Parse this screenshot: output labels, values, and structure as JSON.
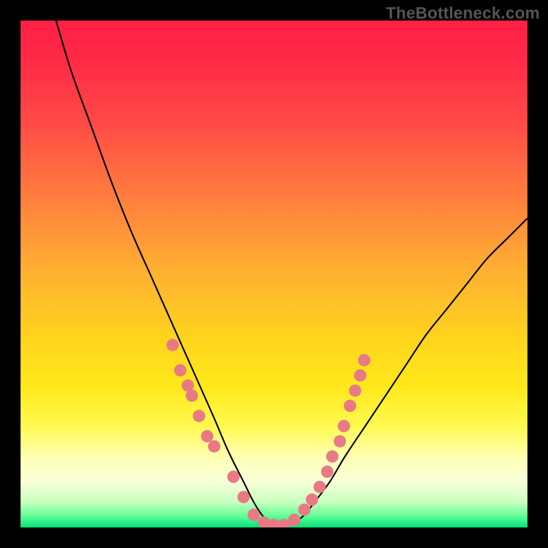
{
  "watermark": "TheBottleneck.com",
  "chart_data": {
    "type": "line",
    "title": "",
    "xlabel": "",
    "ylabel": "",
    "xlim": [
      0,
      100
    ],
    "ylim": [
      0,
      100
    ],
    "background_gradient": {
      "stops": [
        {
          "offset": 0.0,
          "color": "#ff1f44"
        },
        {
          "offset": 0.08,
          "color": "#ff2a47"
        },
        {
          "offset": 0.2,
          "color": "#ff4a46"
        },
        {
          "offset": 0.35,
          "color": "#ff7e3d"
        },
        {
          "offset": 0.5,
          "color": "#ffb230"
        },
        {
          "offset": 0.62,
          "color": "#ffd21e"
        },
        {
          "offset": 0.72,
          "color": "#ffe81a"
        },
        {
          "offset": 0.8,
          "color": "#fff94f"
        },
        {
          "offset": 0.86,
          "color": "#ffffb2"
        },
        {
          "offset": 0.91,
          "color": "#f8ffd8"
        },
        {
          "offset": 0.95,
          "color": "#c8ffc0"
        },
        {
          "offset": 0.975,
          "color": "#6dff9a"
        },
        {
          "offset": 1.0,
          "color": "#00e57a"
        }
      ]
    },
    "series": [
      {
        "name": "bottleneck-curve",
        "x": [
          7,
          10,
          14,
          18,
          22,
          26,
          30,
          34,
          38,
          41,
          44,
          46,
          48,
          50,
          52,
          54,
          56,
          58,
          61,
          64,
          68,
          72,
          76,
          80,
          84,
          88,
          92,
          96,
          100
        ],
        "y": [
          100,
          90,
          79,
          68,
          58,
          49,
          40,
          31,
          22,
          15,
          9,
          5,
          2,
          0.5,
          0.5,
          1,
          2.5,
          5,
          9,
          14,
          20,
          26,
          32,
          38,
          43,
          48,
          53,
          57,
          61
        ]
      }
    ],
    "scatter": {
      "name": "sample-points",
      "color": "#e97a85",
      "points": [
        {
          "x": 30.0,
          "y": 36
        },
        {
          "x": 31.5,
          "y": 31
        },
        {
          "x": 33.0,
          "y": 28
        },
        {
          "x": 33.8,
          "y": 26
        },
        {
          "x": 35.2,
          "y": 22
        },
        {
          "x": 36.8,
          "y": 18
        },
        {
          "x": 38.2,
          "y": 16
        },
        {
          "x": 42.0,
          "y": 10
        },
        {
          "x": 44.0,
          "y": 6
        },
        {
          "x": 46.0,
          "y": 2.5
        },
        {
          "x": 48.0,
          "y": 1
        },
        {
          "x": 50.0,
          "y": 0.5
        },
        {
          "x": 52.0,
          "y": 0.5
        },
        {
          "x": 54.0,
          "y": 1.5
        },
        {
          "x": 56.0,
          "y": 3.5
        },
        {
          "x": 57.5,
          "y": 5.5
        },
        {
          "x": 59.0,
          "y": 8
        },
        {
          "x": 60.5,
          "y": 11
        },
        {
          "x": 61.5,
          "y": 14
        },
        {
          "x": 63.0,
          "y": 17
        },
        {
          "x": 63.8,
          "y": 20
        },
        {
          "x": 65.0,
          "y": 24
        },
        {
          "x": 66.0,
          "y": 27
        },
        {
          "x": 67.0,
          "y": 30
        },
        {
          "x": 67.8,
          "y": 33
        }
      ]
    }
  }
}
